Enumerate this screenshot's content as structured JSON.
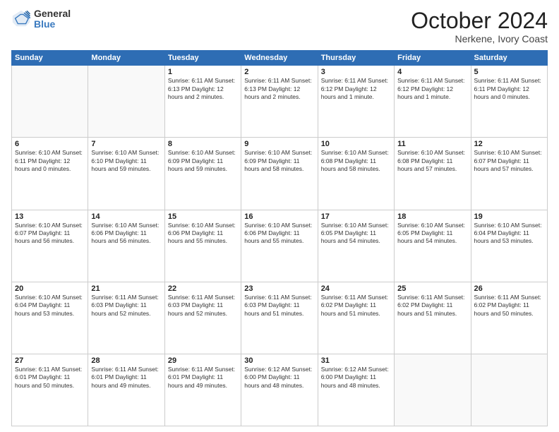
{
  "logo": {
    "general": "General",
    "blue": "Blue"
  },
  "title": "October 2024",
  "location": "Nerkene, Ivory Coast",
  "days_header": [
    "Sunday",
    "Monday",
    "Tuesday",
    "Wednesday",
    "Thursday",
    "Friday",
    "Saturday"
  ],
  "weeks": [
    [
      {
        "num": "",
        "info": ""
      },
      {
        "num": "",
        "info": ""
      },
      {
        "num": "1",
        "info": "Sunrise: 6:11 AM\nSunset: 6:13 PM\nDaylight: 12 hours\nand 2 minutes."
      },
      {
        "num": "2",
        "info": "Sunrise: 6:11 AM\nSunset: 6:13 PM\nDaylight: 12 hours\nand 2 minutes."
      },
      {
        "num": "3",
        "info": "Sunrise: 6:11 AM\nSunset: 6:12 PM\nDaylight: 12 hours\nand 1 minute."
      },
      {
        "num": "4",
        "info": "Sunrise: 6:11 AM\nSunset: 6:12 PM\nDaylight: 12 hours\nand 1 minute."
      },
      {
        "num": "5",
        "info": "Sunrise: 6:11 AM\nSunset: 6:11 PM\nDaylight: 12 hours\nand 0 minutes."
      }
    ],
    [
      {
        "num": "6",
        "info": "Sunrise: 6:10 AM\nSunset: 6:11 PM\nDaylight: 12 hours\nand 0 minutes."
      },
      {
        "num": "7",
        "info": "Sunrise: 6:10 AM\nSunset: 6:10 PM\nDaylight: 11 hours\nand 59 minutes."
      },
      {
        "num": "8",
        "info": "Sunrise: 6:10 AM\nSunset: 6:09 PM\nDaylight: 11 hours\nand 59 minutes."
      },
      {
        "num": "9",
        "info": "Sunrise: 6:10 AM\nSunset: 6:09 PM\nDaylight: 11 hours\nand 58 minutes."
      },
      {
        "num": "10",
        "info": "Sunrise: 6:10 AM\nSunset: 6:08 PM\nDaylight: 11 hours\nand 58 minutes."
      },
      {
        "num": "11",
        "info": "Sunrise: 6:10 AM\nSunset: 6:08 PM\nDaylight: 11 hours\nand 57 minutes."
      },
      {
        "num": "12",
        "info": "Sunrise: 6:10 AM\nSunset: 6:07 PM\nDaylight: 11 hours\nand 57 minutes."
      }
    ],
    [
      {
        "num": "13",
        "info": "Sunrise: 6:10 AM\nSunset: 6:07 PM\nDaylight: 11 hours\nand 56 minutes."
      },
      {
        "num": "14",
        "info": "Sunrise: 6:10 AM\nSunset: 6:06 PM\nDaylight: 11 hours\nand 56 minutes."
      },
      {
        "num": "15",
        "info": "Sunrise: 6:10 AM\nSunset: 6:06 PM\nDaylight: 11 hours\nand 55 minutes."
      },
      {
        "num": "16",
        "info": "Sunrise: 6:10 AM\nSunset: 6:06 PM\nDaylight: 11 hours\nand 55 minutes."
      },
      {
        "num": "17",
        "info": "Sunrise: 6:10 AM\nSunset: 6:05 PM\nDaylight: 11 hours\nand 54 minutes."
      },
      {
        "num": "18",
        "info": "Sunrise: 6:10 AM\nSunset: 6:05 PM\nDaylight: 11 hours\nand 54 minutes."
      },
      {
        "num": "19",
        "info": "Sunrise: 6:10 AM\nSunset: 6:04 PM\nDaylight: 11 hours\nand 53 minutes."
      }
    ],
    [
      {
        "num": "20",
        "info": "Sunrise: 6:10 AM\nSunset: 6:04 PM\nDaylight: 11 hours\nand 53 minutes."
      },
      {
        "num": "21",
        "info": "Sunrise: 6:11 AM\nSunset: 6:03 PM\nDaylight: 11 hours\nand 52 minutes."
      },
      {
        "num": "22",
        "info": "Sunrise: 6:11 AM\nSunset: 6:03 PM\nDaylight: 11 hours\nand 52 minutes."
      },
      {
        "num": "23",
        "info": "Sunrise: 6:11 AM\nSunset: 6:03 PM\nDaylight: 11 hours\nand 51 minutes."
      },
      {
        "num": "24",
        "info": "Sunrise: 6:11 AM\nSunset: 6:02 PM\nDaylight: 11 hours\nand 51 minutes."
      },
      {
        "num": "25",
        "info": "Sunrise: 6:11 AM\nSunset: 6:02 PM\nDaylight: 11 hours\nand 51 minutes."
      },
      {
        "num": "26",
        "info": "Sunrise: 6:11 AM\nSunset: 6:02 PM\nDaylight: 11 hours\nand 50 minutes."
      }
    ],
    [
      {
        "num": "27",
        "info": "Sunrise: 6:11 AM\nSunset: 6:01 PM\nDaylight: 11 hours\nand 50 minutes."
      },
      {
        "num": "28",
        "info": "Sunrise: 6:11 AM\nSunset: 6:01 PM\nDaylight: 11 hours\nand 49 minutes."
      },
      {
        "num": "29",
        "info": "Sunrise: 6:11 AM\nSunset: 6:01 PM\nDaylight: 11 hours\nand 49 minutes."
      },
      {
        "num": "30",
        "info": "Sunrise: 6:12 AM\nSunset: 6:00 PM\nDaylight: 11 hours\nand 48 minutes."
      },
      {
        "num": "31",
        "info": "Sunrise: 6:12 AM\nSunset: 6:00 PM\nDaylight: 11 hours\nand 48 minutes."
      },
      {
        "num": "",
        "info": ""
      },
      {
        "num": "",
        "info": ""
      }
    ]
  ]
}
